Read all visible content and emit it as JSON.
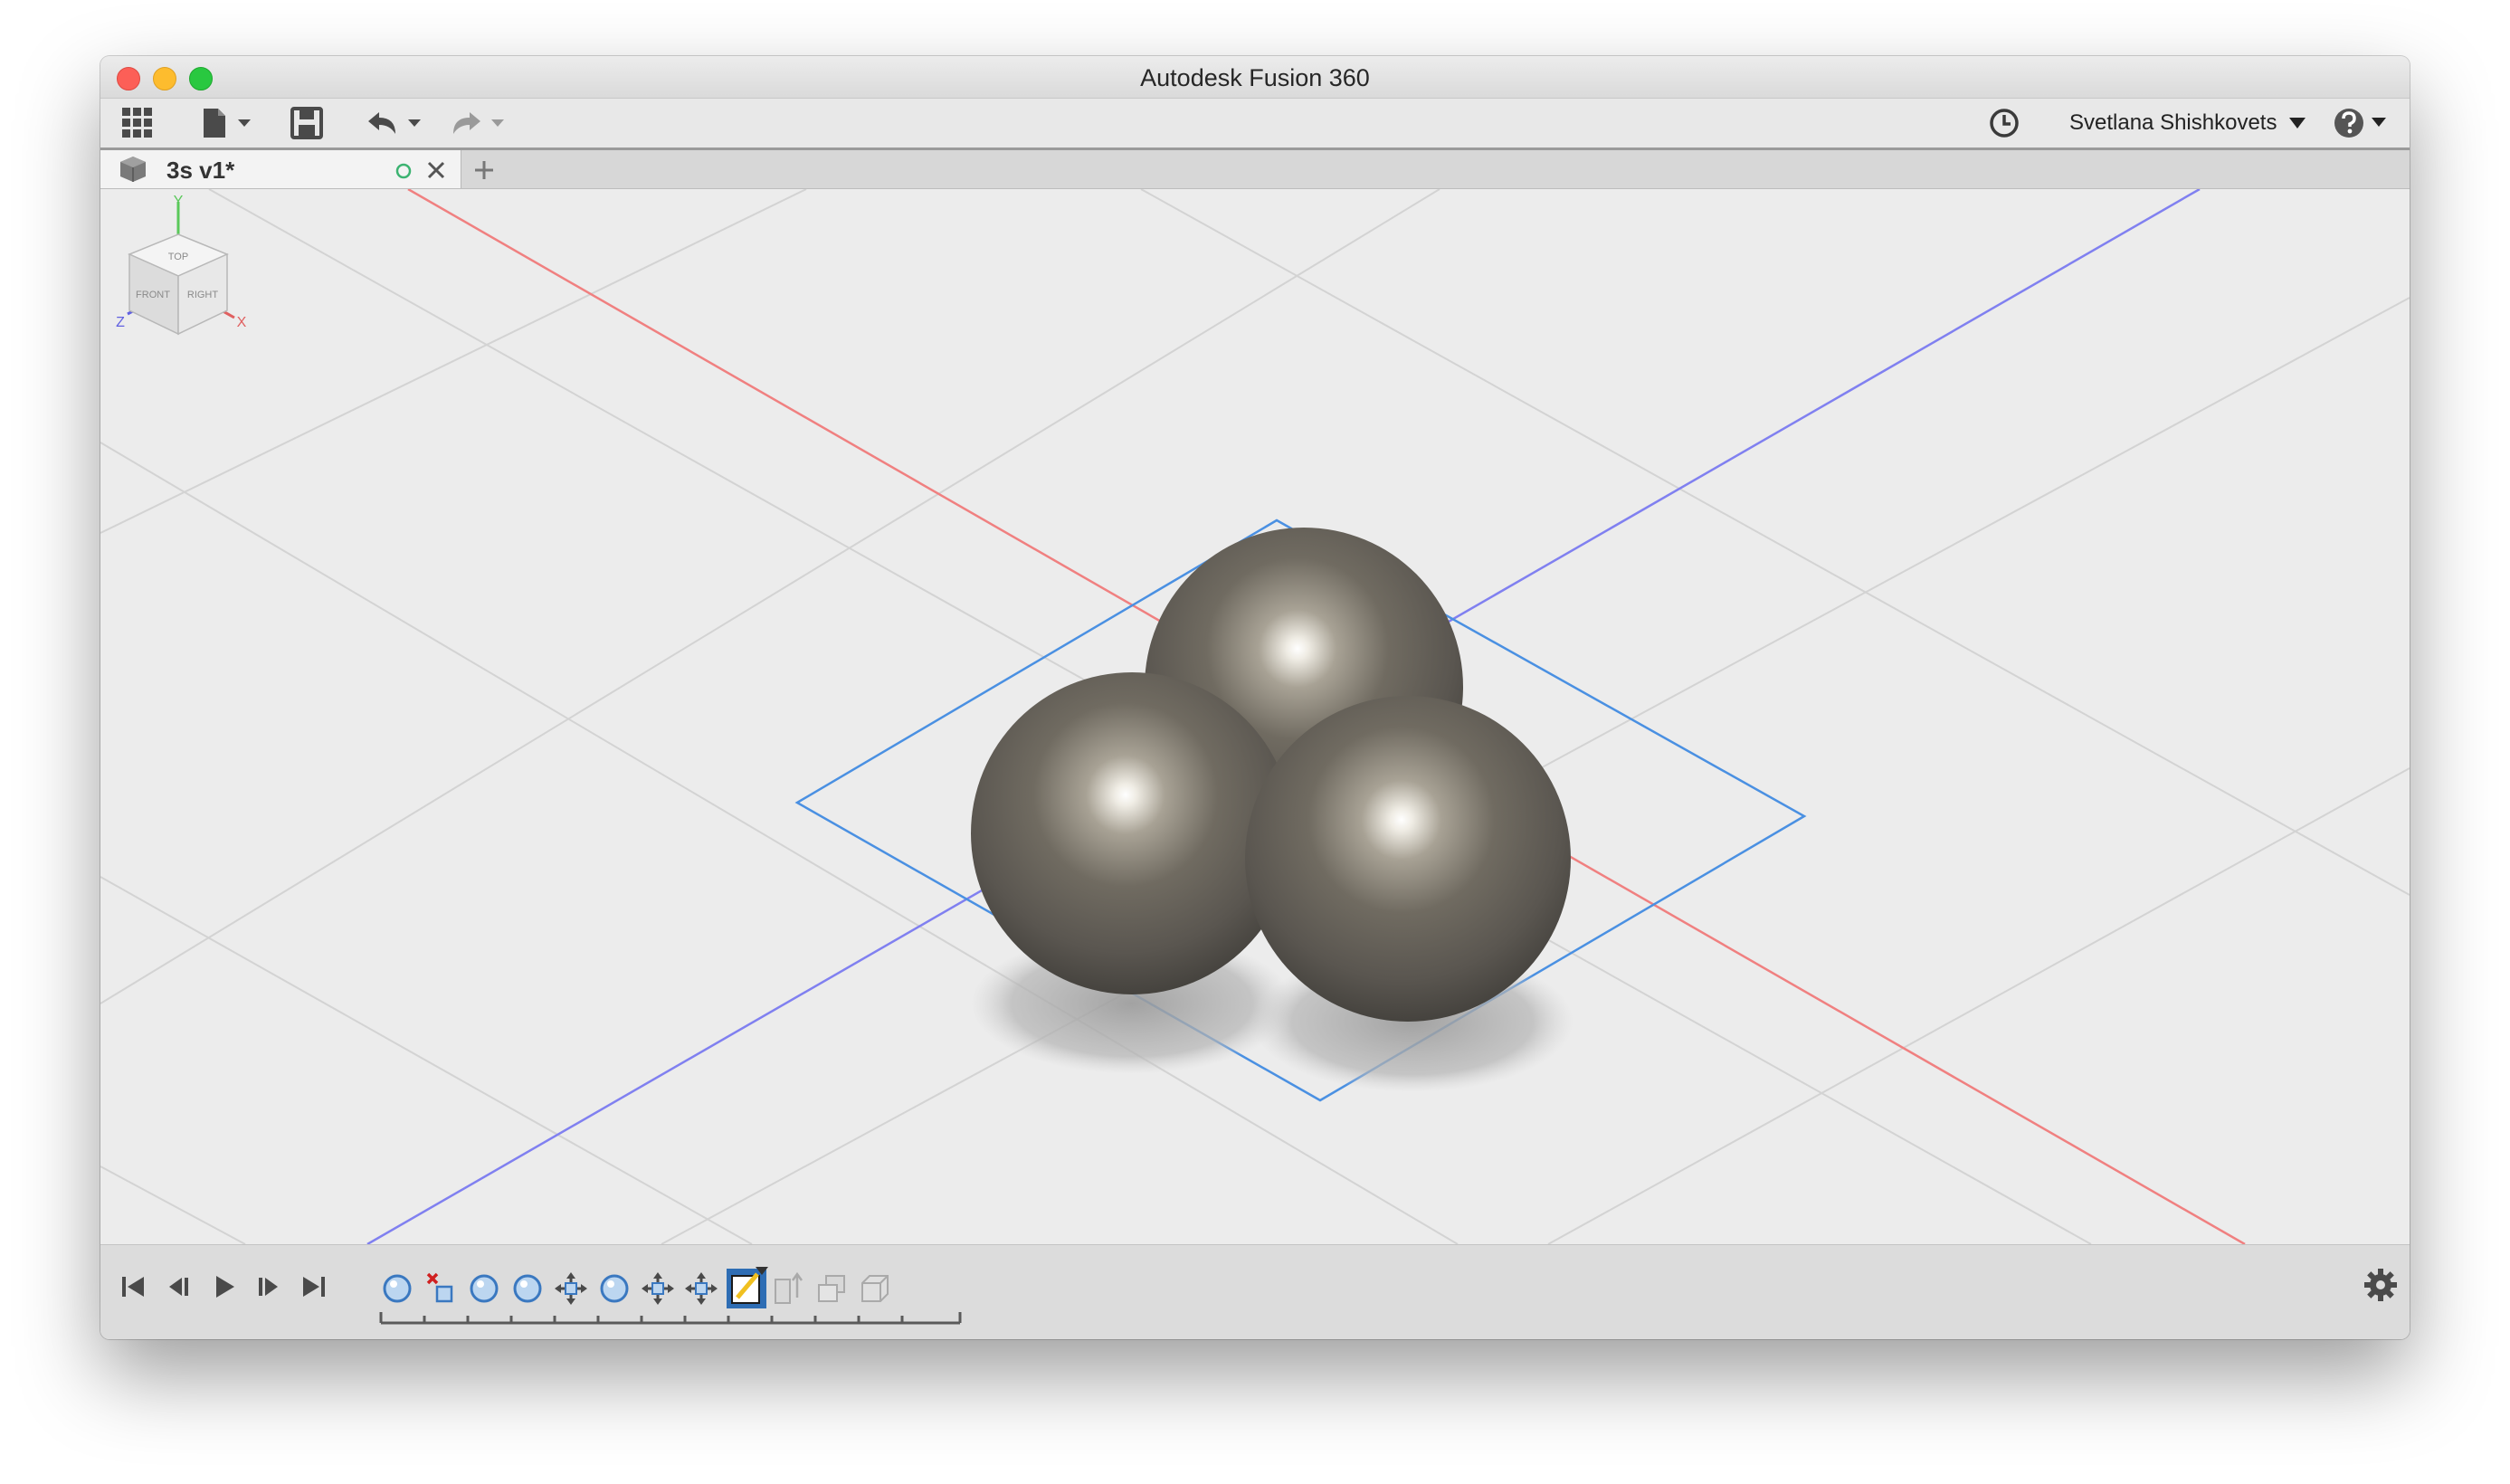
{
  "window": {
    "title": "Autodesk Fusion 360"
  },
  "toolbar": {
    "items": [
      {
        "name": "data-panel-grid-icon"
      },
      {
        "name": "file-menu"
      },
      {
        "name": "save"
      },
      {
        "name": "undo"
      },
      {
        "name": "redo"
      }
    ],
    "job_status_icon": "clock-icon",
    "user_name": "Svetlana Shishkovets",
    "help_icon": "question-icon"
  },
  "tabs": [
    {
      "label": "3s v1*",
      "modified_indicator": "circle-icon",
      "close_icon": "close-icon"
    }
  ],
  "new_tab_icon": "plus-icon",
  "viewcube": {
    "faces": [
      "TOP",
      "FRONT",
      "RIGHT"
    ],
    "axes": [
      "Y",
      "Z",
      "X"
    ]
  },
  "colors": {
    "x_axis": "#f08080",
    "z_axis": "#8080f0",
    "selection": "#4a90e2",
    "timeline_active": "#2e6db4"
  },
  "timeline": {
    "playback_controls": [
      "skip-to-start",
      "step-back",
      "play",
      "step-forward",
      "skip-to-end"
    ],
    "features": [
      "sphere-feature",
      "delete-feature",
      "sphere-feature",
      "sphere-feature",
      "move-feature",
      "sphere-feature",
      "move-feature",
      "move-feature",
      "sketch-feature",
      "extrude-feature",
      "combine-feature",
      "shell-feature"
    ],
    "active_feature_index": 8
  },
  "settings_icon": "gear-icon"
}
